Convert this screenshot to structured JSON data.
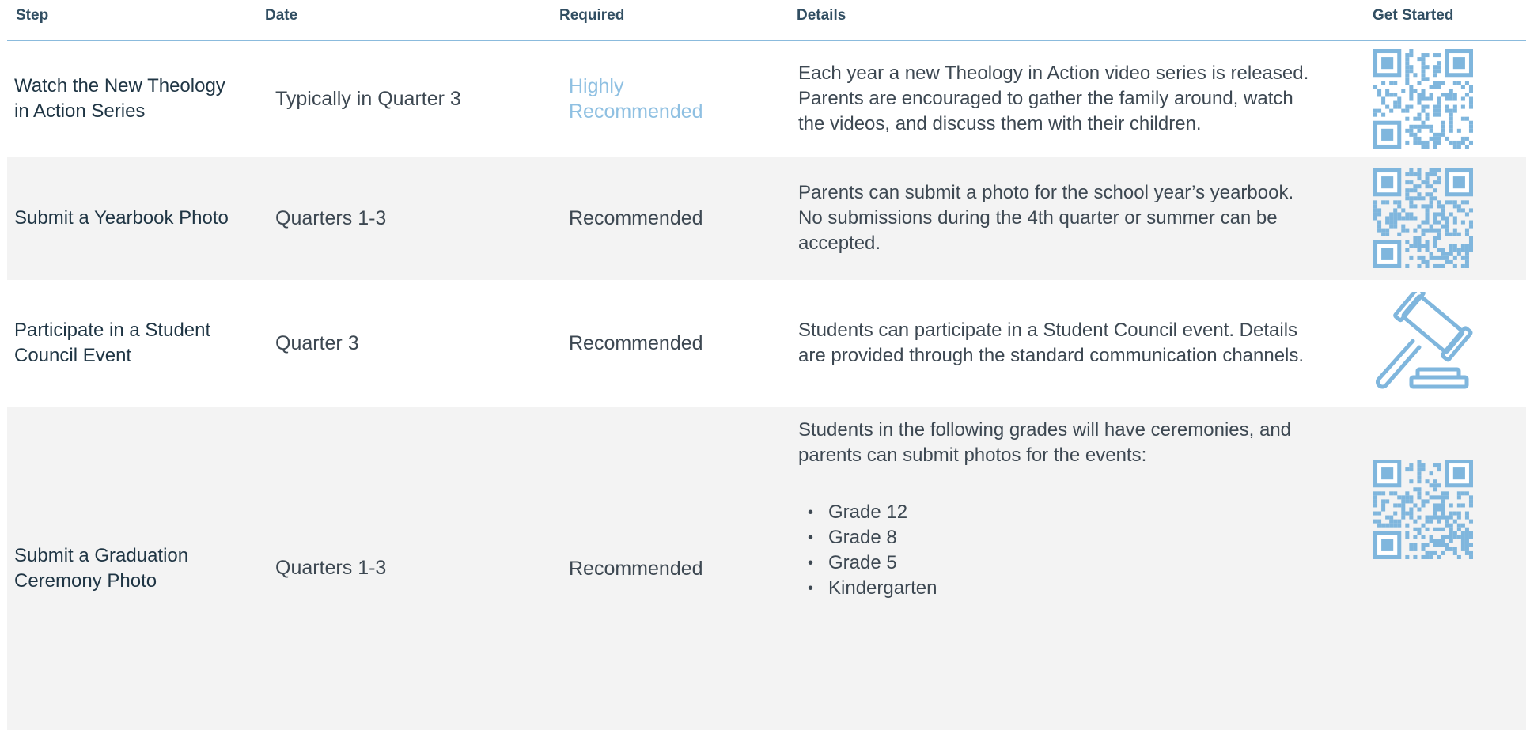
{
  "table": {
    "headers": {
      "step": "Step",
      "date": "Date",
      "required": "Required",
      "details": "Details",
      "get_started": "Get Started"
    },
    "rows": [
      {
        "step": "Watch the New Theology in Action Series",
        "date": "Typically in Quarter 3",
        "required": "Highly Recommended",
        "details": "Each year a new Theology in Action video series is released. Parents are encouraged to gather the family around, watch the videos, and discuss them with their children.",
        "action_icon": "qr-code-icon"
      },
      {
        "step": "Submit a Yearbook Photo",
        "date": "Quarters 1-3",
        "required": "Recommended",
        "details": "Parents can submit a photo for the school year’s yearbook. No submissions during the 4th quarter or summer can be accepted.",
        "action_icon": "qr-code-icon"
      },
      {
        "step": "Participate in a Student Council Event",
        "date": "Quarter 3",
        "required": "Recommended",
        "details": "Students can participate in a Student Council event. Details are provided through the standard communication channels.",
        "action_icon": "gavel-icon"
      },
      {
        "step": "Submit a Graduation Ceremony Photo",
        "date": "Quarters 1-3",
        "required": "Recommended",
        "details": "Students in the following grades will have ceremonies, and parents can submit photos for the events:",
        "details_list": [
          "Grade 12",
          "Grade 8",
          "Grade 5",
          "Kindergarten"
        ],
        "action_icon": "qr-code-icon"
      }
    ]
  },
  "colors": {
    "header_text": "#314e62",
    "header_rule": "#8bbbdd",
    "accent_blue": "#7fb6dd",
    "row_shade": "#f3f3f3",
    "body_text": "#3d4852"
  }
}
